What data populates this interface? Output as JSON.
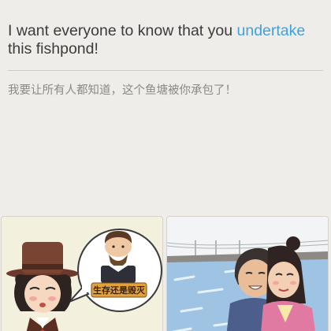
{
  "question": {
    "prefix": "I want everyone to know that you ",
    "highlight_word": "undertake",
    "suffix": " this fishpond!",
    "highlight_color": "#3fa2dc"
  },
  "translation": "我要让所有人都知道，这个鱼塘被你承包了！",
  "options": [
    {
      "label": "生存还是毁灭",
      "icon": "gentleman-with-shakespeare-bubble-illustration"
    },
    {
      "label": "",
      "icon": "couple-at-fishpond-illustration"
    }
  ]
}
